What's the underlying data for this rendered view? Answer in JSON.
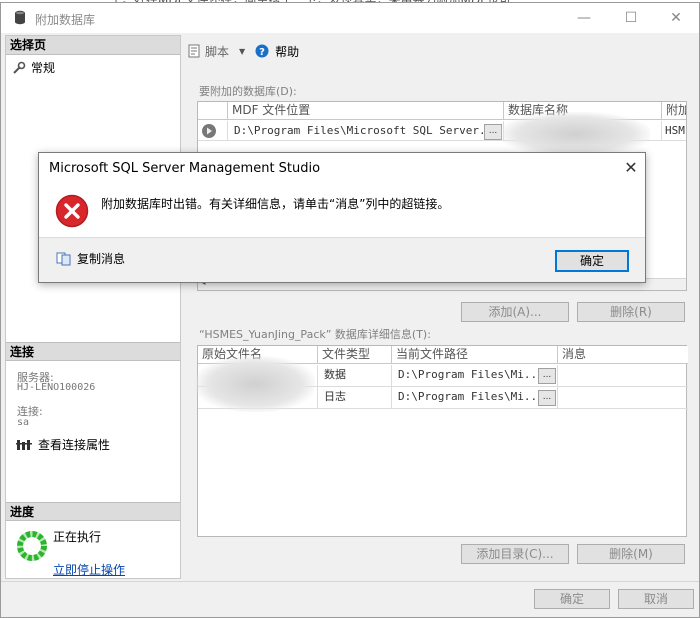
{
  "background": {
    "text": "了。好在MDF文件还在，简单搜了一下，发现其实，采用暴力附加MDF也可"
  },
  "window": {
    "title": "附加数据库",
    "minimize": "—",
    "maximize": "☐",
    "close": "✕"
  },
  "left_pane": {
    "select_page_header": "选择页",
    "pages": [
      {
        "label": "常规",
        "icon": "wrench-icon"
      }
    ],
    "connection_header": "连接",
    "server_label": "服务器:",
    "server_value": "HJ-LENO100026",
    "user_label": "连接:",
    "user_value": "sa",
    "view_properties": "查看连接属性",
    "progress_header": "进度",
    "progress_status": "正在执行",
    "stop_link": "立即停止操作"
  },
  "toolbar": {
    "script_label": "脚本",
    "dropdown_arrow": "▼",
    "help_label": "帮助"
  },
  "attach_section": {
    "label": "要附加的数据库(D):",
    "columns": [
      "MDF 文件位置",
      "数据库名称",
      "附加"
    ],
    "rows": [
      {
        "mdf_location": "D:\\Program Files\\Microsoft SQL Server...",
        "browse": "...",
        "attach_as": "HSM"
      }
    ]
  },
  "buttons": {
    "add": "添加(A)...",
    "remove": "删除(R)",
    "add_catalog": "添加目录(C)...",
    "remove2": "删除(M)",
    "ok": "确定",
    "cancel": "取消"
  },
  "details_section": {
    "label": "“HSMES_YuanJing_Pack” 数据库详细信息(T):",
    "columns": [
      "原始文件名",
      "文件类型",
      "当前文件路径",
      "消息"
    ],
    "rows": [
      {
        "type": "数据",
        "path": "D:\\Program Files\\Mi...",
        "browse": "..."
      },
      {
        "type": "日志",
        "path": "D:\\Program Files\\Mi...",
        "browse": "..."
      }
    ]
  },
  "message_box": {
    "title": "Microsoft SQL Server Management Studio",
    "close": "✕",
    "text": "附加数据库时出错。有关详细信息，请单击“消息”列中的超链接。",
    "copy_message": "复制消息",
    "ok": "确定"
  },
  "colors": {
    "accent": "#0078d7",
    "error": "#d9262b",
    "link": "#0645ad"
  }
}
